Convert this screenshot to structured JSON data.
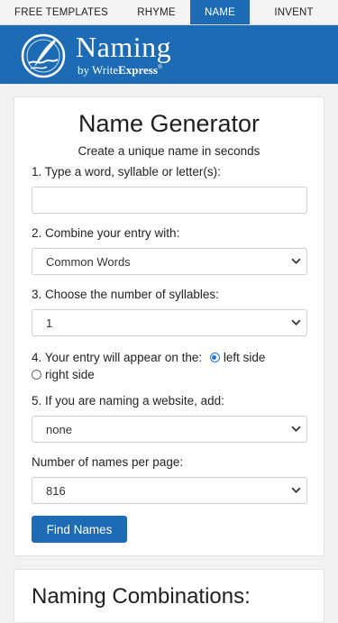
{
  "nav": {
    "tabs": [
      "FREE TEMPLATES",
      "RHYME",
      "NAME",
      "INVENT"
    ],
    "active_index": 2
  },
  "brand": {
    "title": "Naming",
    "by": "by",
    "write": "Write",
    "express": "Express",
    "mark": "®",
    "bg_color": "#1c6bb4"
  },
  "form": {
    "title": "Name Generator",
    "subtitle": "Create a unique name in seconds",
    "step1_label": "1. Type a word, syllable or letter(s):",
    "step1_value": "",
    "step2_label": "2. Combine your entry with:",
    "step2_value": "Common Words",
    "step3_label": "3. Choose the number of syllables:",
    "step3_value": "1",
    "step4_label": "4. Your entry will appear on the:",
    "step4_opt_left": "left side",
    "step4_opt_right": "right side",
    "step4_selected": "left side",
    "step5_label": "5. If you are naming a website, add:",
    "step5_value": "none",
    "perpage_label": "Number of names per page:",
    "perpage_value": "816",
    "submit_label": "Find Names"
  },
  "results": {
    "title": "Naming Combinations:"
  }
}
